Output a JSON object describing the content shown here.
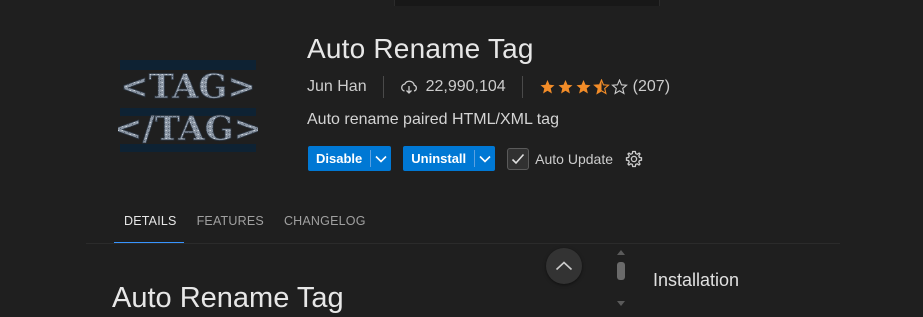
{
  "extension": {
    "name": "Auto Rename Tag",
    "publisher": "Jun Han",
    "installs": "22,990,104",
    "rating": {
      "stars": 3.5,
      "max": 5,
      "count_label": "(207)"
    },
    "description": "Auto rename paired HTML/XML tag",
    "icon_lines": [
      "<TAG>",
      "</TAG>"
    ]
  },
  "actions": {
    "disable_label": "Disable",
    "uninstall_label": "Uninstall",
    "auto_update_label": "Auto Update",
    "auto_update_checked": true
  },
  "tabs": [
    {
      "label": "DETAILS",
      "active": true
    },
    {
      "label": "FEATURES",
      "active": false
    },
    {
      "label": "CHANGELOG",
      "active": false
    }
  ],
  "readme": {
    "heading": "Auto Rename Tag"
  },
  "sidebar": {
    "heading": "Installation"
  },
  "colors": {
    "background": "#1f1f1f",
    "button_primary": "#0078d4",
    "star": "#f28c28",
    "tab_active_underline": "#3794ff"
  }
}
